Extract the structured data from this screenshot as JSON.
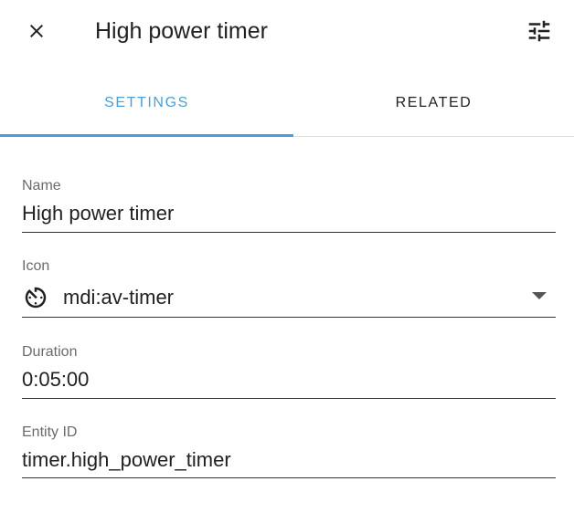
{
  "dialog": {
    "title": "High power timer",
    "close_icon": "close-icon",
    "settings_icon": "tune-icon"
  },
  "tabs": [
    {
      "label": "SETTINGS",
      "active": true
    },
    {
      "label": "RELATED",
      "active": false
    }
  ],
  "colors": {
    "accent": "#4a9fd6",
    "text": "#212121",
    "label": "#6b6b6b"
  },
  "fields": {
    "name": {
      "label": "Name",
      "value": "High power timer"
    },
    "icon": {
      "label": "Icon",
      "value": "mdi:av-timer",
      "icon": "av-timer-icon"
    },
    "duration": {
      "label": "Duration",
      "value": "0:05:00"
    },
    "entity_id": {
      "label": "Entity ID",
      "value": "timer.high_power_timer"
    }
  }
}
